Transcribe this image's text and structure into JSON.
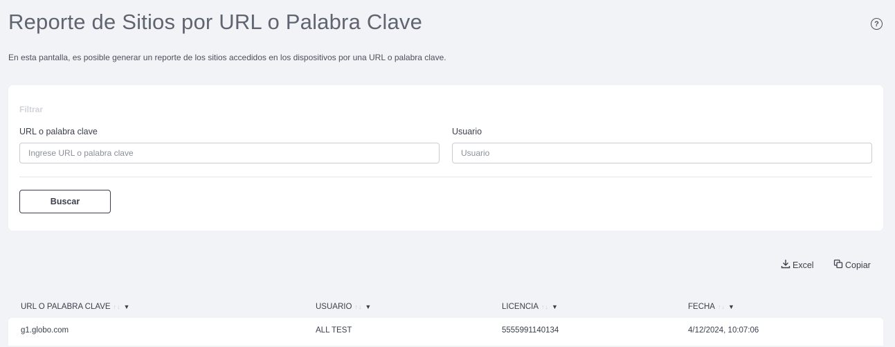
{
  "header": {
    "title": "Reporte de Sitios por URL o Palabra Clave",
    "description": "En esta pantalla, es posible generar un reporte de los sitios accedidos en los dispositivos por una URL o palabra clave.",
    "help_icon": "?"
  },
  "filter": {
    "title": "Filtrar",
    "url_label": "URL o palabra clave",
    "url_placeholder": "Ingrese URL o palabra clave",
    "url_value": "",
    "user_label": "Usuario",
    "user_placeholder": "Usuario",
    "user_value": "",
    "search_button": "Buscar"
  },
  "actions": {
    "excel": "Excel",
    "copy": "Copiar"
  },
  "table": {
    "columns": [
      "URL O PALABRA CLAVE",
      "USUARIO",
      "LICENCIA",
      "FECHA"
    ],
    "sort_arrows": "↑↓",
    "rows": [
      [
        "g1.globo.com",
        "ALL TEST",
        "5555991140134",
        "4/12/2024, 10:07:06"
      ]
    ]
  }
}
